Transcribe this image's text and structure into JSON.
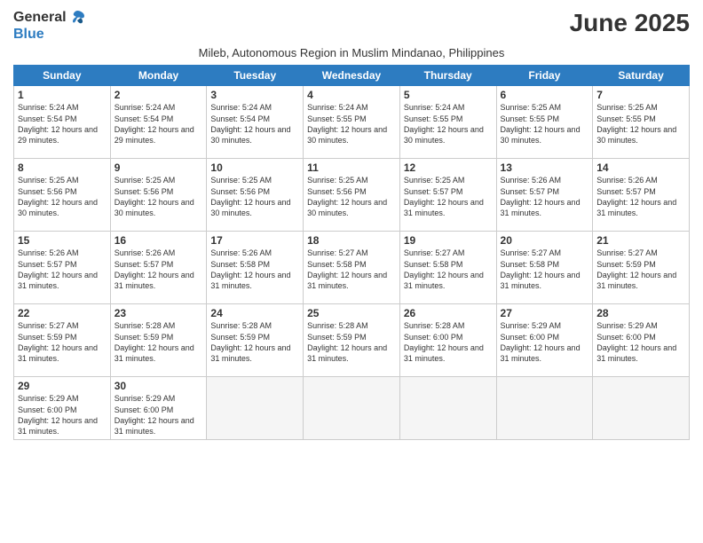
{
  "logo": {
    "line1": "General",
    "line2": "Blue"
  },
  "title": "June 2025",
  "subtitle": "Mileb, Autonomous Region in Muslim Mindanao, Philippines",
  "days_header": [
    "Sunday",
    "Monday",
    "Tuesday",
    "Wednesday",
    "Thursday",
    "Friday",
    "Saturday"
  ],
  "weeks": [
    [
      {
        "day": "1",
        "sunrise": "5:24 AM",
        "sunset": "5:54 PM",
        "daylight": "12 hours and 29 minutes."
      },
      {
        "day": "2",
        "sunrise": "5:24 AM",
        "sunset": "5:54 PM",
        "daylight": "12 hours and 29 minutes."
      },
      {
        "day": "3",
        "sunrise": "5:24 AM",
        "sunset": "5:54 PM",
        "daylight": "12 hours and 30 minutes."
      },
      {
        "day": "4",
        "sunrise": "5:24 AM",
        "sunset": "5:55 PM",
        "daylight": "12 hours and 30 minutes."
      },
      {
        "day": "5",
        "sunrise": "5:24 AM",
        "sunset": "5:55 PM",
        "daylight": "12 hours and 30 minutes."
      },
      {
        "day": "6",
        "sunrise": "5:25 AM",
        "sunset": "5:55 PM",
        "daylight": "12 hours and 30 minutes."
      },
      {
        "day": "7",
        "sunrise": "5:25 AM",
        "sunset": "5:55 PM",
        "daylight": "12 hours and 30 minutes."
      }
    ],
    [
      {
        "day": "8",
        "sunrise": "5:25 AM",
        "sunset": "5:56 PM",
        "daylight": "12 hours and 30 minutes."
      },
      {
        "day": "9",
        "sunrise": "5:25 AM",
        "sunset": "5:56 PM",
        "daylight": "12 hours and 30 minutes."
      },
      {
        "day": "10",
        "sunrise": "5:25 AM",
        "sunset": "5:56 PM",
        "daylight": "12 hours and 30 minutes."
      },
      {
        "day": "11",
        "sunrise": "5:25 AM",
        "sunset": "5:56 PM",
        "daylight": "12 hours and 30 minutes."
      },
      {
        "day": "12",
        "sunrise": "5:25 AM",
        "sunset": "5:57 PM",
        "daylight": "12 hours and 31 minutes."
      },
      {
        "day": "13",
        "sunrise": "5:26 AM",
        "sunset": "5:57 PM",
        "daylight": "12 hours and 31 minutes."
      },
      {
        "day": "14",
        "sunrise": "5:26 AM",
        "sunset": "5:57 PM",
        "daylight": "12 hours and 31 minutes."
      }
    ],
    [
      {
        "day": "15",
        "sunrise": "5:26 AM",
        "sunset": "5:57 PM",
        "daylight": "12 hours and 31 minutes."
      },
      {
        "day": "16",
        "sunrise": "5:26 AM",
        "sunset": "5:57 PM",
        "daylight": "12 hours and 31 minutes."
      },
      {
        "day": "17",
        "sunrise": "5:26 AM",
        "sunset": "5:58 PM",
        "daylight": "12 hours and 31 minutes."
      },
      {
        "day": "18",
        "sunrise": "5:27 AM",
        "sunset": "5:58 PM",
        "daylight": "12 hours and 31 minutes."
      },
      {
        "day": "19",
        "sunrise": "5:27 AM",
        "sunset": "5:58 PM",
        "daylight": "12 hours and 31 minutes."
      },
      {
        "day": "20",
        "sunrise": "5:27 AM",
        "sunset": "5:58 PM",
        "daylight": "12 hours and 31 minutes."
      },
      {
        "day": "21",
        "sunrise": "5:27 AM",
        "sunset": "5:59 PM",
        "daylight": "12 hours and 31 minutes."
      }
    ],
    [
      {
        "day": "22",
        "sunrise": "5:27 AM",
        "sunset": "5:59 PM",
        "daylight": "12 hours and 31 minutes."
      },
      {
        "day": "23",
        "sunrise": "5:28 AM",
        "sunset": "5:59 PM",
        "daylight": "12 hours and 31 minutes."
      },
      {
        "day": "24",
        "sunrise": "5:28 AM",
        "sunset": "5:59 PM",
        "daylight": "12 hours and 31 minutes."
      },
      {
        "day": "25",
        "sunrise": "5:28 AM",
        "sunset": "5:59 PM",
        "daylight": "12 hours and 31 minutes."
      },
      {
        "day": "26",
        "sunrise": "5:28 AM",
        "sunset": "6:00 PM",
        "daylight": "12 hours and 31 minutes."
      },
      {
        "day": "27",
        "sunrise": "5:29 AM",
        "sunset": "6:00 PM",
        "daylight": "12 hours and 31 minutes."
      },
      {
        "day": "28",
        "sunrise": "5:29 AM",
        "sunset": "6:00 PM",
        "daylight": "12 hours and 31 minutes."
      }
    ],
    [
      {
        "day": "29",
        "sunrise": "5:29 AM",
        "sunset": "6:00 PM",
        "daylight": "12 hours and 31 minutes."
      },
      {
        "day": "30",
        "sunrise": "5:29 AM",
        "sunset": "6:00 PM",
        "daylight": "12 hours and 31 minutes."
      },
      null,
      null,
      null,
      null,
      null
    ]
  ]
}
